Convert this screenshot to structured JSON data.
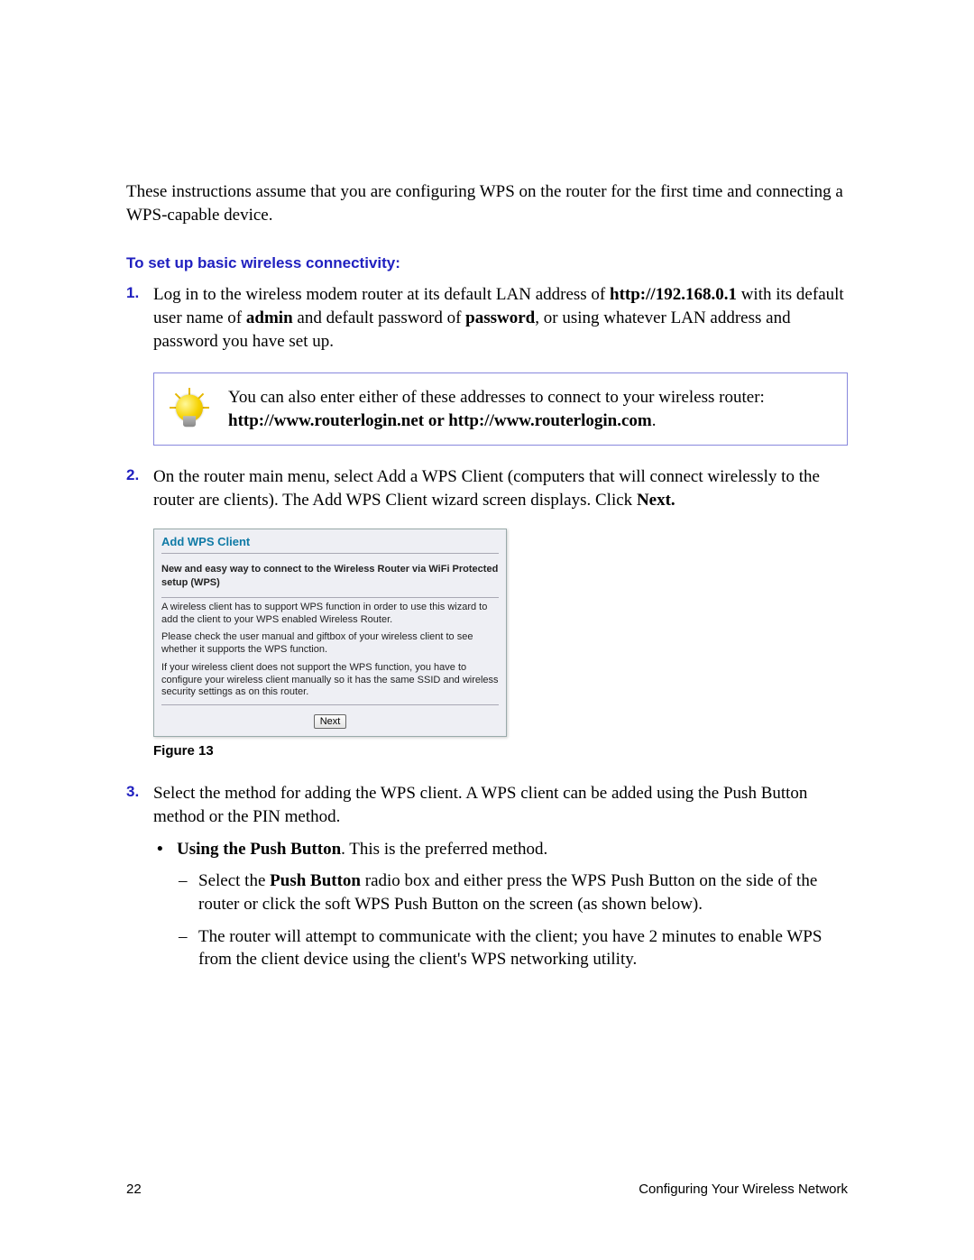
{
  "intro": "These instructions assume that you are configuring WPS on the router for the first time and connecting a WPS-capable device.",
  "section_heading": "To set up basic wireless connectivity:",
  "step1": {
    "pre": "Log in to the wireless modem router at its default LAN address of ",
    "url": "http://192.168.0.1",
    "mid1": " with its default user name of ",
    "admin": "admin",
    "mid2": " and default password of ",
    "password": "password",
    "post": ", or using whatever LAN address and password you have set up."
  },
  "tip": {
    "line1": "You can also enter either of these addresses to connect to your wireless router:",
    "url1": "http://www.routerlogin.net",
    "sep": " or ",
    "url2": "http://www.routerlogin.com",
    "dot": "."
  },
  "step2": {
    "text_pre": "On the router main menu, select Add a WPS Client (computers that will connect wirelessly to the router are clients). The Add WPS Client wizard screen displays. Click ",
    "next": "Next.",
    "text_post": ""
  },
  "wps_panel": {
    "title": "Add WPS Client",
    "intro": "New and easy way to connect to the Wireless Router via WiFi Protected setup (WPS)",
    "p1": "A wireless client has to support WPS function in order to use this wizard to add the client to your WPS enabled Wireless Router.",
    "p2": "Please check the user manual and giftbox of your wireless client to see whether it supports the WPS function.",
    "p3": "If your wireless client does not support the WPS function, you have to configure your wireless client manually so it has the same SSID and wireless security settings as on this router.",
    "next_button": "Next"
  },
  "figure_caption": "Figure 13",
  "step3": {
    "text": "Select the method for adding the WPS client. A WPS client can be added using the Push Button method or the PIN method.",
    "bullet1_label": "Using the Push Button",
    "bullet1_rest": ". This is the preferred method.",
    "dash1_pre": "Select the ",
    "dash1_bold": "Push Button",
    "dash1_post": " radio box and either press the WPS Push Button on the side of the router or click the soft WPS Push Button on the screen (as shown below).",
    "dash2": "The router will attempt to communicate with the client; you have 2 minutes to enable WPS from the client device using the client's WPS networking utility."
  },
  "footer": {
    "page_number": "22",
    "section": "Configuring Your Wireless Network"
  }
}
